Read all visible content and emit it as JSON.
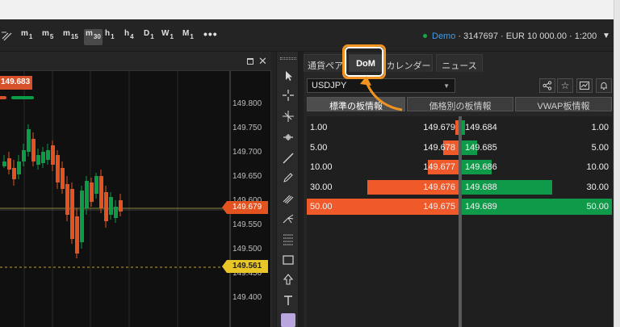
{
  "toolbar": {
    "timeframes": [
      {
        "main": "m",
        "sub": "1"
      },
      {
        "main": "m",
        "sub": "5"
      },
      {
        "main": "m",
        "sub": "15"
      },
      {
        "main": "m",
        "sub": "30"
      },
      {
        "main": "h",
        "sub": "1"
      },
      {
        "main": "h",
        "sub": "4"
      },
      {
        "main": "D",
        "sub": "1"
      },
      {
        "main": "W",
        "sub": "1"
      },
      {
        "main": "M",
        "sub": "1"
      }
    ],
    "selected_timeframe": "m30",
    "more": "•••"
  },
  "account": {
    "mode": "Demo",
    "details": " · 3147697 · EUR 10 000.00 · 1:200",
    "status_color": "#1aa34a"
  },
  "chart": {
    "price_labels": [
      "149.800",
      "149.750",
      "149.700",
      "149.650",
      "149.600",
      "149.550",
      "149.500",
      "149.450",
      "149.400"
    ],
    "bid_tag": "149.679",
    "line_tag": "149.561",
    "top_tag": "149.683",
    "colors": {
      "bull": "#0a9d46",
      "bear": "#e2531f",
      "alert": "#e8c628"
    }
  },
  "panel": {
    "tabs": [
      "通貨ペア",
      "DoM",
      "カレンダー",
      "ニュース"
    ],
    "active_tab": "DoM",
    "symbol": "USDJPY",
    "icons": [
      "share-icon",
      "star-icon",
      "chart-icon",
      "bell-icon"
    ],
    "modes": [
      "標準の板情報",
      "価格別の板情報",
      "VWAP板情報"
    ],
    "active_mode": "標準の板情報"
  },
  "book": {
    "bids": [
      {
        "volume": "1.00",
        "price": "149.679",
        "fill": 0.02
      },
      {
        "volume": "5.00",
        "price": "149.678",
        "fill": 0.1
      },
      {
        "volume": "10.00",
        "price": "149.677",
        "fill": 0.2
      },
      {
        "volume": "30.00",
        "price": "149.676",
        "fill": 0.6
      },
      {
        "volume": "50.00",
        "price": "149.675",
        "fill": 1.0
      }
    ],
    "asks": [
      {
        "price": "149.684",
        "volume": "1.00",
        "fill": 0.02
      },
      {
        "price": "149.685",
        "volume": "5.00",
        "fill": 0.1
      },
      {
        "price": "149.686",
        "volume": "10.00",
        "fill": 0.2
      },
      {
        "price": "149.688",
        "volume": "30.00",
        "fill": 0.6
      },
      {
        "price": "149.689",
        "volume": "50.00",
        "fill": 1.0
      }
    ]
  }
}
